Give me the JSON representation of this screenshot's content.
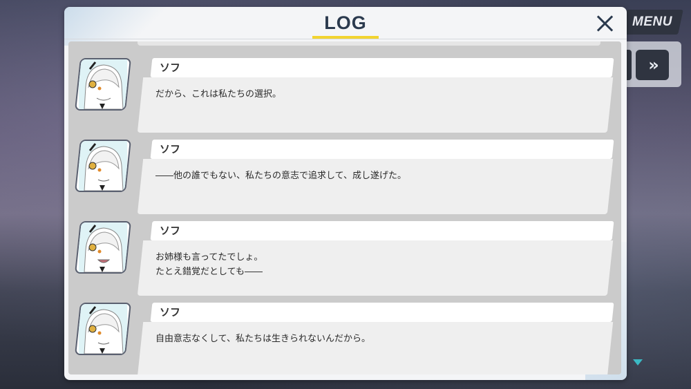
{
  "header": {
    "title": "LOG",
    "close_icon": "close-icon"
  },
  "side_menu": {
    "menu_label": "MENU",
    "fast_forward_label": "»"
  },
  "log_entries": [
    {
      "speaker": "ソフ",
      "text": "だから、これは私たちの選択。"
    },
    {
      "speaker": "ソフ",
      "text": "――他の誰でもない、私たちの意志で追求して、成し遂げた。"
    },
    {
      "speaker": "ソフ",
      "text": "お姉様も言ってたでしょ。\nたとえ錯覚だとしても――"
    },
    {
      "speaker": "ソフ",
      "text": "自由意志なくして、私たちは生きられないんだから。"
    }
  ],
  "colors": {
    "title_underline": "#f2d430",
    "title_text": "#2b3a4e",
    "scroll_indicator": "#3bb9c4",
    "menu_button": "#2f3440"
  }
}
